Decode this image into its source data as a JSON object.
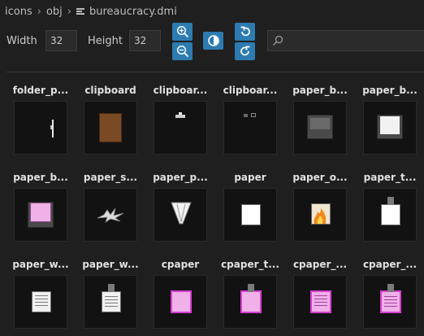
{
  "breadcrumb": {
    "segments": [
      "icons",
      "obj"
    ],
    "file": "bureaucracy.dmi"
  },
  "toolbar": {
    "width_label": "Width",
    "width_value": "32",
    "height_label": "Height",
    "height_value": "32",
    "search_placeholder": ""
  },
  "icons": {
    "row1": [
      "folder_p...",
      "clipboard",
      "clipboar...",
      "clipboar...",
      "paper_b...",
      "paper_b..."
    ],
    "row2": [
      "paper_b...",
      "paper_s...",
      "paper_p...",
      "paper",
      "paper_o...",
      "paper_t..."
    ],
    "row3": [
      "paper_w...",
      "paper_w...",
      "cpaper",
      "cpaper_t...",
      "cpaper_...",
      "cpaper_..."
    ]
  },
  "colors": {
    "accent": "#2d7bb0",
    "background": "#1f1f1f",
    "thumb_bg": "#121212",
    "pink": "#f0b0e8",
    "magenta": "#d63fd0"
  }
}
